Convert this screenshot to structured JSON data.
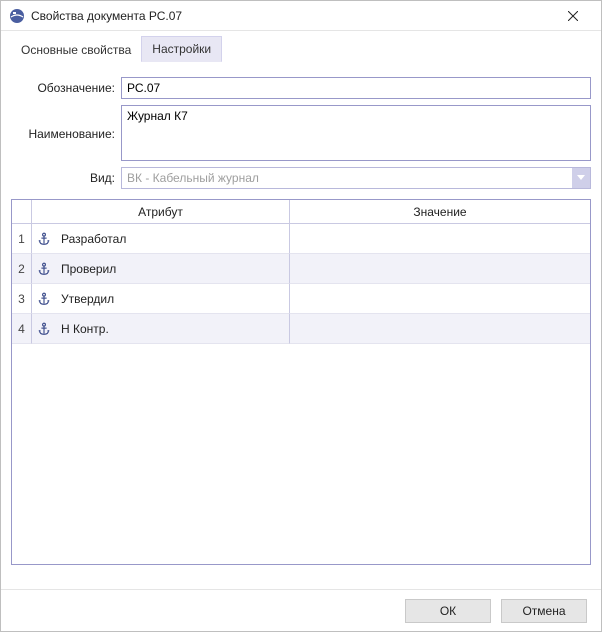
{
  "window": {
    "title": "Свойства документа РС.07"
  },
  "tabs": [
    {
      "label": "Основные свойства",
      "active": false
    },
    {
      "label": "Настройки",
      "active": true
    }
  ],
  "form": {
    "designation_label": "Обозначение:",
    "designation_value": "РС.07",
    "name_label": "Наименование:",
    "name_value": "Журнал К7",
    "kind_label": "Вид:",
    "kind_value": "ВК - Кабельный журнал"
  },
  "grid": {
    "headers": {
      "attribute": "Атрибут",
      "value": "Значение"
    },
    "rows": [
      {
        "num": "1",
        "icon": "anchor-icon",
        "attribute": "Разработал",
        "value": ""
      },
      {
        "num": "2",
        "icon": "anchor-icon",
        "attribute": "Проверил",
        "value": ""
      },
      {
        "num": "3",
        "icon": "anchor-icon",
        "attribute": "Утвердил",
        "value": ""
      },
      {
        "num": "4",
        "icon": "anchor-icon",
        "attribute": "Н Контр.",
        "value": ""
      }
    ]
  },
  "buttons": {
    "ok": "ОК",
    "cancel": "Отмена"
  },
  "colors": {
    "accent_border": "#9898c9",
    "tab_active_bg": "#e8e7f4",
    "row_alt_bg": "#f2f2f9"
  }
}
